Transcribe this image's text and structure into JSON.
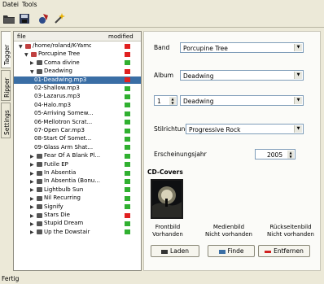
{
  "menu": [
    "Datei",
    "Tools"
  ],
  "toolbar": [
    "folder-icon",
    "save-icon",
    "tag-icon",
    "wand-icon"
  ],
  "vtabs": [
    "Tagger",
    "Ripper",
    "Settings"
  ],
  "tree": {
    "col_file": "file",
    "col_modified": "modified",
    "rows": [
      {
        "name": "/home/roland/K-Yamo-T...",
        "mark": "red"
      },
      {
        "name": "Porcupine Tree",
        "mark": "red"
      },
      {
        "name": "Coma divine",
        "mark": "green"
      },
      {
        "name": "Deadwing",
        "mark": "red"
      },
      {
        "name": "01-Deadwing.mp3",
        "mark": "red"
      },
      {
        "name": "02-Shallow.mp3",
        "mark": "green"
      },
      {
        "name": "03-Lazarus.mp3",
        "mark": "green"
      },
      {
        "name": "04-Halo.mp3",
        "mark": "green"
      },
      {
        "name": "05-Arriving Somew...",
        "mark": "green"
      },
      {
        "name": "06-Mellotron Scrat...",
        "mark": "green"
      },
      {
        "name": "07-Open Car.mp3",
        "mark": "green"
      },
      {
        "name": "08-Start Of Somet...",
        "mark": "green"
      },
      {
        "name": "09-Glass Arm Shat...",
        "mark": "green"
      },
      {
        "name": "Fear Of A Blank Pl...",
        "mark": "green"
      },
      {
        "name": "Futile EP",
        "mark": "green"
      },
      {
        "name": "In Absentia",
        "mark": "green"
      },
      {
        "name": "In Absentia (Bonu...",
        "mark": "green"
      },
      {
        "name": "Lightbulb Sun",
        "mark": "green"
      },
      {
        "name": "Nil Recurring",
        "mark": "green"
      },
      {
        "name": "Signify",
        "mark": "green"
      },
      {
        "name": "Stars Die",
        "mark": "red"
      },
      {
        "name": "Stupid Dream",
        "mark": "green"
      },
      {
        "name": "Up the Dowstair",
        "mark": "green"
      }
    ]
  },
  "form": {
    "band_label": "Band",
    "band_value": "Porcupine Tree",
    "album_label": "Album",
    "album_value": "Deadwing",
    "cd_number": "1",
    "cd_value": "Deadwing",
    "style_label": "Stilrichtung",
    "style_value": "Progressive Rock",
    "year_label": "Erscheinungsjahr",
    "year_value": "2005"
  },
  "covers": {
    "title": "CD-Covers",
    "front": "Frontbild\nVorhanden",
    "media": "Medienbild\nNicht vorhanden",
    "back": "Rückseitenbild\nNicht vorhanden",
    "load": "Laden",
    "find": "Finde",
    "remove": "Entfernen"
  },
  "status": "Fertig",
  "colors": {
    "selection": "#3a6ea5",
    "red_mark": "#e02020",
    "green_mark": "#30b030"
  }
}
